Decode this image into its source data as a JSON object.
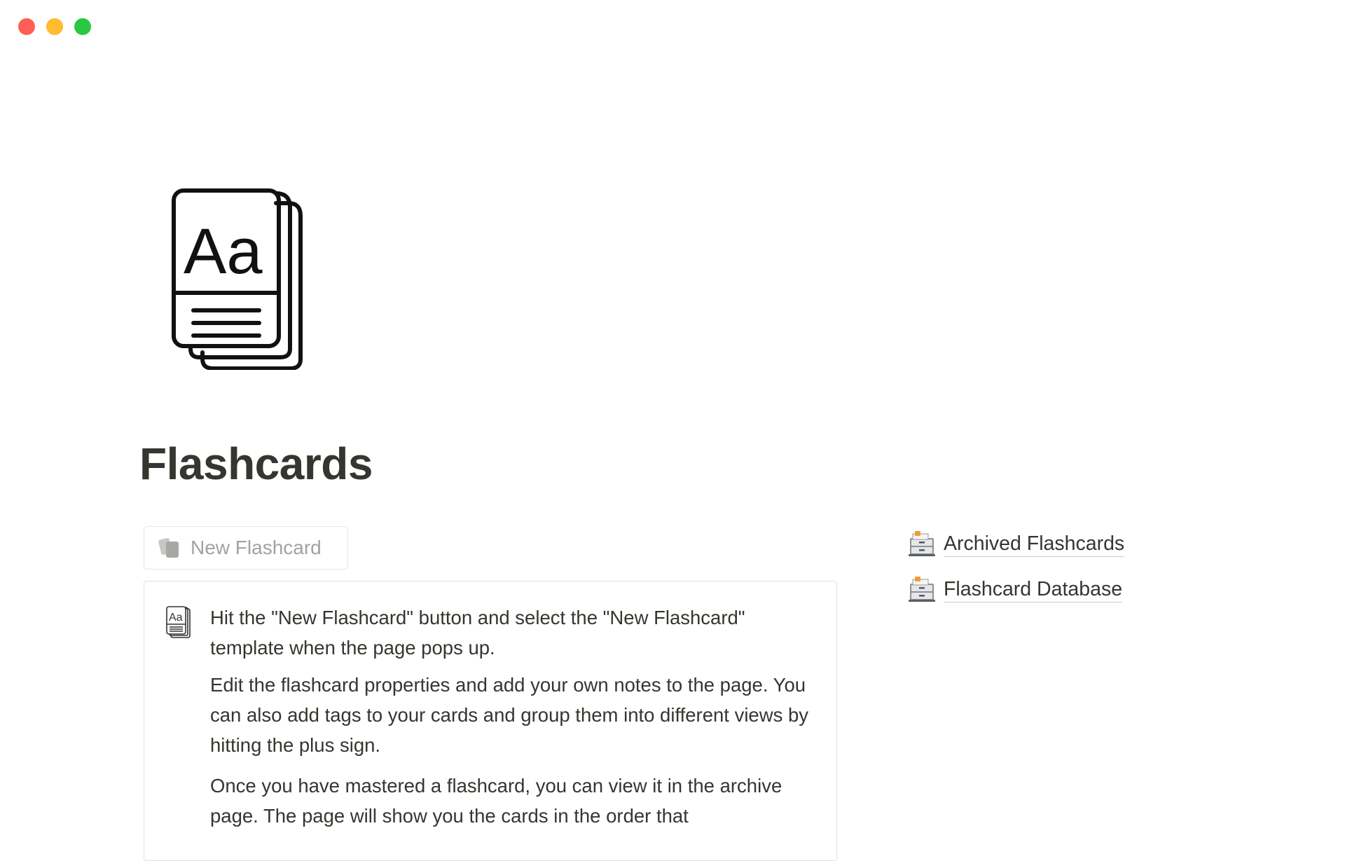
{
  "window": {
    "controls": [
      "close",
      "minimize",
      "zoom"
    ]
  },
  "page": {
    "icon": "book-aa-icon",
    "title": "Flashcards"
  },
  "new_flashcard_button": {
    "icon": "cards-icon",
    "label": "New Flashcard"
  },
  "callout": {
    "icon": "book-aa-icon",
    "paragraphs": [
      "Hit the \"New Flashcard\" button and select the \"New Flashcard\" template when the page pops up.",
      "Edit the flashcard properties and add your own notes to the page. You can also add tags to your cards and group them into different views by hitting the plus sign.",
      "Once you have mastered a flashcard, you can view it in the archive page. The page will show you the cards in the order that"
    ]
  },
  "linked_pages": [
    {
      "icon": "file-cabinet-icon",
      "label": "Archived Flashcards"
    },
    {
      "icon": "file-cabinet-icon",
      "label": "Flashcard Database"
    }
  ],
  "colors": {
    "text": "#37352f",
    "muted": "#a3a29e",
    "border": "#e3e2e0",
    "close": "#ff5f57",
    "minimize": "#febc2e",
    "zoom": "#28c840"
  }
}
